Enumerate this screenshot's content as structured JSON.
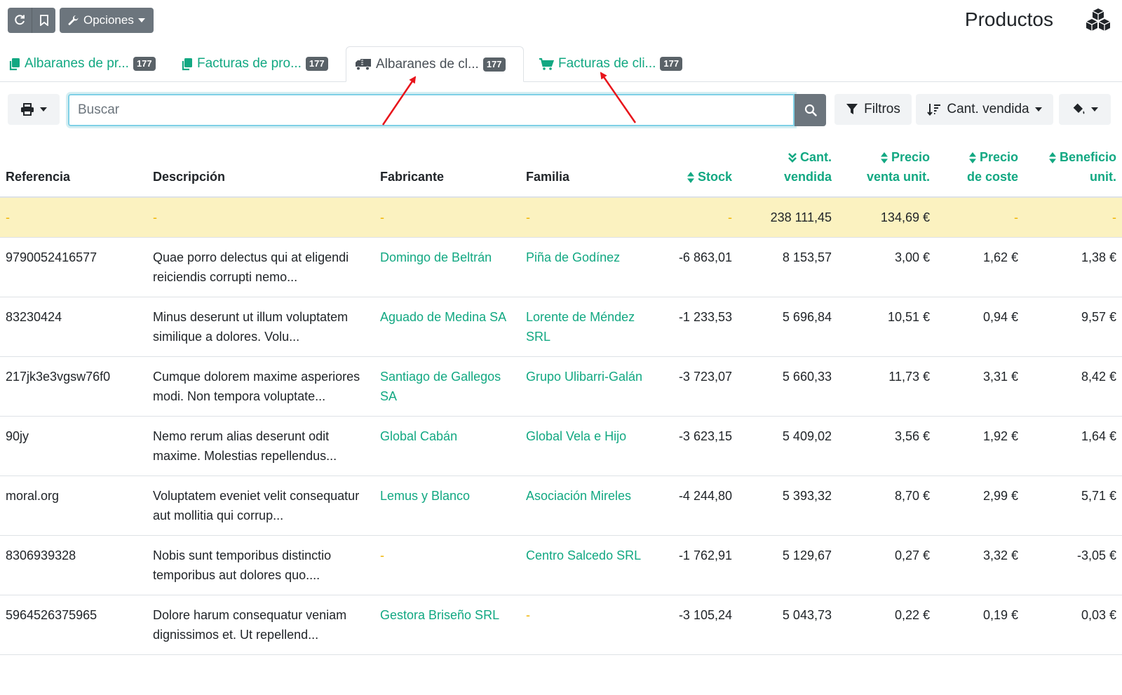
{
  "header": {
    "options_label": "Opciones",
    "page_title": "Productos"
  },
  "tabs": [
    {
      "label": "Albaranes de pr...",
      "count": "177",
      "icon": "copy-icon"
    },
    {
      "label": "Facturas de pro...",
      "count": "177",
      "icon": "copy-icon"
    },
    {
      "label": "Albaranes de cl...",
      "count": "177",
      "icon": "truck-icon",
      "active": true
    },
    {
      "label": "Facturas de cli...",
      "count": "177",
      "icon": "shopping-cart-icon"
    }
  ],
  "toolbar": {
    "search_placeholder": "Buscar",
    "filters_label": "Filtros",
    "sort_label": "Cant. vendida"
  },
  "table": {
    "columns": {
      "reference": "Referencia",
      "description": "Descripción",
      "manufacturer": "Fabricante",
      "family": "Familia",
      "stock": "Stock",
      "qty_sold_1": "Cant.",
      "qty_sold_2": "vendida",
      "unit_price_1": "Precio",
      "unit_price_2": "venta unit.",
      "cost_price_1": "Precio",
      "cost_price_2": "de coste",
      "unit_profit_1": "Beneficio",
      "unit_profit_2": "unit."
    },
    "totals": {
      "reference": "-",
      "description": "-",
      "manufacturer": "-",
      "family": "-",
      "stock": "-",
      "qty_sold": "238 111,45",
      "unit_price": "134,69 €",
      "cost_price": "-",
      "unit_profit": "-"
    },
    "rows": [
      {
        "reference": "9790052416577",
        "description": "Quae porro delectus qui at eligendi reiciendis corrupti nemo...",
        "manufacturer": "Domingo de Beltrán",
        "family": "Piña de Godínez",
        "stock": "-6 863,01",
        "qty_sold": "8 153,57",
        "unit_price": "3,00 €",
        "cost_price": "1,62 €",
        "unit_profit": "1,38 €"
      },
      {
        "reference": "83230424",
        "description": "Minus deserunt ut illum voluptatem similique a dolores. Volu...",
        "manufacturer": "Aguado de Medina SA",
        "family": "Lorente de Méndez SRL",
        "stock": "-1 233,53",
        "qty_sold": "5 696,84",
        "unit_price": "10,51 €",
        "cost_price": "0,94 €",
        "unit_profit": "9,57 €"
      },
      {
        "reference": "217jk3e3vgsw76f0",
        "description": "Cumque dolorem maxime asperiores modi. Non tempora voluptate...",
        "manufacturer": "Santiago de Gallegos SA",
        "family": "Grupo Ulibarri-Galán",
        "stock": "-3 723,07",
        "qty_sold": "5 660,33",
        "unit_price": "11,73 €",
        "cost_price": "3,31 €",
        "unit_profit": "8,42 €"
      },
      {
        "reference": "90jy",
        "description": "Nemo rerum alias deserunt odit maxime. Molestias repellendus...",
        "manufacturer": "Global Cabán",
        "family": "Global Vela e Hijo",
        "stock": "-3 623,15",
        "qty_sold": "5 409,02",
        "unit_price": "3,56 €",
        "cost_price": "1,92 €",
        "unit_profit": "1,64 €"
      },
      {
        "reference": "moral.org",
        "description": "Voluptatem eveniet velit consequatur aut mollitia qui corrup...",
        "manufacturer": "Lemus y Blanco",
        "family": "Asociación Mireles",
        "stock": "-4 244,80",
        "qty_sold": "5 393,32",
        "unit_price": "8,70 €",
        "cost_price": "2,99 €",
        "unit_profit": "5,71 €"
      },
      {
        "reference": "8306939328",
        "description": "Nobis sunt temporibus distinctio temporibus aut dolores quo....",
        "manufacturer": "-",
        "family": "Centro Salcedo SRL",
        "stock": "-1 762,91",
        "qty_sold": "5 129,67",
        "unit_price": "0,27 €",
        "cost_price": "3,32 €",
        "unit_profit": "-3,05 €"
      },
      {
        "reference": "5964526375965",
        "description": "Dolore harum consequatur veniam dignissimos et. Ut repellend...",
        "manufacturer": "Gestora Briseño SRL",
        "family": "-",
        "stock": "-3 105,24",
        "qty_sold": "5 043,73",
        "unit_price": "0,22 €",
        "cost_price": "0,19 €",
        "unit_profit": "0,03 €"
      }
    ]
  },
  "colors": {
    "accent": "#12a882",
    "totals_row_bg": "#fbf2c0",
    "dash": "#f0b400",
    "annotation_arrow": "#e8141b"
  }
}
